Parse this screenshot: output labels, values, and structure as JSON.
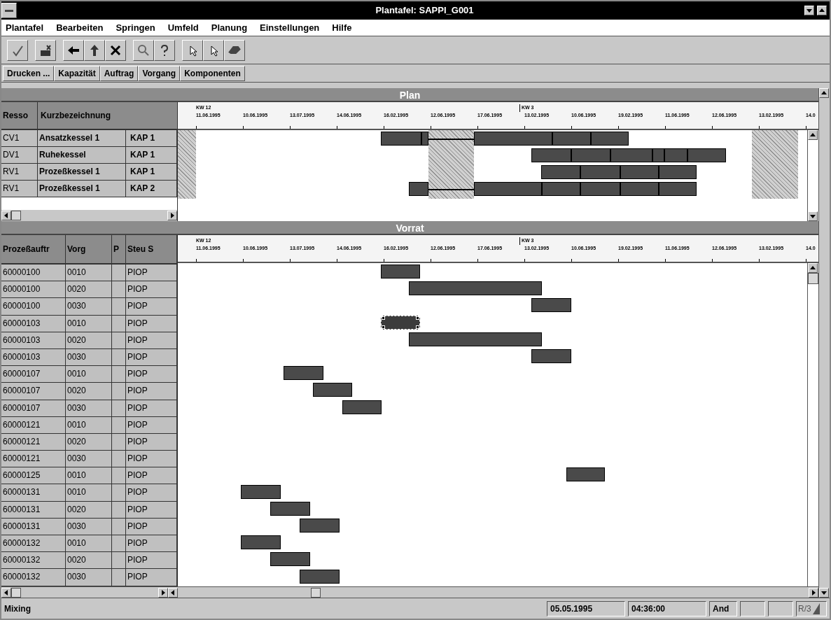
{
  "window": {
    "title": "Plantafel: SAPPI_G001"
  },
  "menu": [
    "Plantafel",
    "Bearbeiten",
    "Springen",
    "Umfeld",
    "Planung",
    "Einstellungen",
    "Hilfe"
  ],
  "buttons": [
    "Drucken ...",
    "Kapazität",
    "Auftrag",
    "Vorgang",
    "Komponenten"
  ],
  "plan": {
    "title": "Plan",
    "columns": [
      "Resso",
      "Kurzbezeichnung"
    ],
    "timeline": {
      "weeks": [
        "KW 12",
        "KW 3"
      ],
      "dates": [
        "11.06.1995",
        "10.06.1995",
        "13.07.1995",
        "14.06.1995",
        "16.02.1995",
        "12.06.1995",
        "17.06.1995",
        "13.02.1995",
        "10.06.1995",
        "19.02.1995",
        "11.06.1995",
        "12.06.1995",
        "13.02.1995",
        "14.0"
      ]
    },
    "rows": [
      {
        "resource": "CV1",
        "name": "Ansatzkessel 1",
        "capacity": "KAP 1"
      },
      {
        "resource": "DV1",
        "name": "Ruhekessel",
        "capacity": "KAP 1"
      },
      {
        "resource": "RV1",
        "name": "Prozeßkessel 1",
        "capacity": "KAP 1"
      },
      {
        "resource": "RV1",
        "name": "Prozeßkessel 1",
        "capacity": "KAP 2"
      }
    ]
  },
  "vorrat": {
    "title": "Vorrat",
    "columns": [
      "Prozeßauftr",
      "Vorg",
      "P",
      "Steu S"
    ],
    "timeline": {
      "weeks": [
        "KW 12",
        "KW 3"
      ],
      "dates": [
        "11.06.1995",
        "10.06.1995",
        "13.07.1995",
        "14.06.1995",
        "16.02.1995",
        "12.06.1995",
        "17.06.1995",
        "13.02.1995",
        "10.06.1995",
        "19.02.1995",
        "11.06.1995",
        "12.06.1995",
        "13.02.1995",
        "14.0"
      ]
    },
    "rows": [
      {
        "order": "60000100",
        "op": "0010",
        "steu": "PIOP",
        "selected": false
      },
      {
        "order": "60000100",
        "op": "0020",
        "steu": "PIOP",
        "selected": false
      },
      {
        "order": "60000100",
        "op": "0030",
        "steu": "PIOP",
        "selected": false
      },
      {
        "order": "60000103",
        "op": "0010",
        "steu": "PIOP",
        "selected": true
      },
      {
        "order": "60000103",
        "op": "0020",
        "steu": "PIOP",
        "selected": false
      },
      {
        "order": "60000103",
        "op": "0030",
        "steu": "PIOP",
        "selected": false
      },
      {
        "order": "60000107",
        "op": "0010",
        "steu": "PIOP",
        "selected": false
      },
      {
        "order": "60000107",
        "op": "0020",
        "steu": "PIOP",
        "selected": false
      },
      {
        "order": "60000107",
        "op": "0030",
        "steu": "PIOP",
        "selected": false
      },
      {
        "order": "60000121",
        "op": "0010",
        "steu": "PIOP",
        "selected": false
      },
      {
        "order": "60000121",
        "op": "0020",
        "steu": "PIOP",
        "selected": false
      },
      {
        "order": "60000121",
        "op": "0030",
        "steu": "PIOP",
        "selected": false
      },
      {
        "order": "60000125",
        "op": "0010",
        "steu": "PIOP",
        "selected": false
      },
      {
        "order": "60000131",
        "op": "0010",
        "steu": "PIOP",
        "selected": false
      },
      {
        "order": "60000131",
        "op": "0020",
        "steu": "PIOP",
        "selected": false
      },
      {
        "order": "60000131",
        "op": "0030",
        "steu": "PIOP",
        "selected": false
      },
      {
        "order": "60000132",
        "op": "0010",
        "steu": "PIOP",
        "selected": false
      },
      {
        "order": "60000132",
        "op": "0020",
        "steu": "PIOP",
        "selected": false
      },
      {
        "order": "60000132",
        "op": "0030",
        "steu": "PIOP",
        "selected": false
      }
    ]
  },
  "status_bar": {
    "message": "Mixing",
    "date": "05.05.1995",
    "time": "04:36:00",
    "mode": "And",
    "system": "R/3"
  }
}
